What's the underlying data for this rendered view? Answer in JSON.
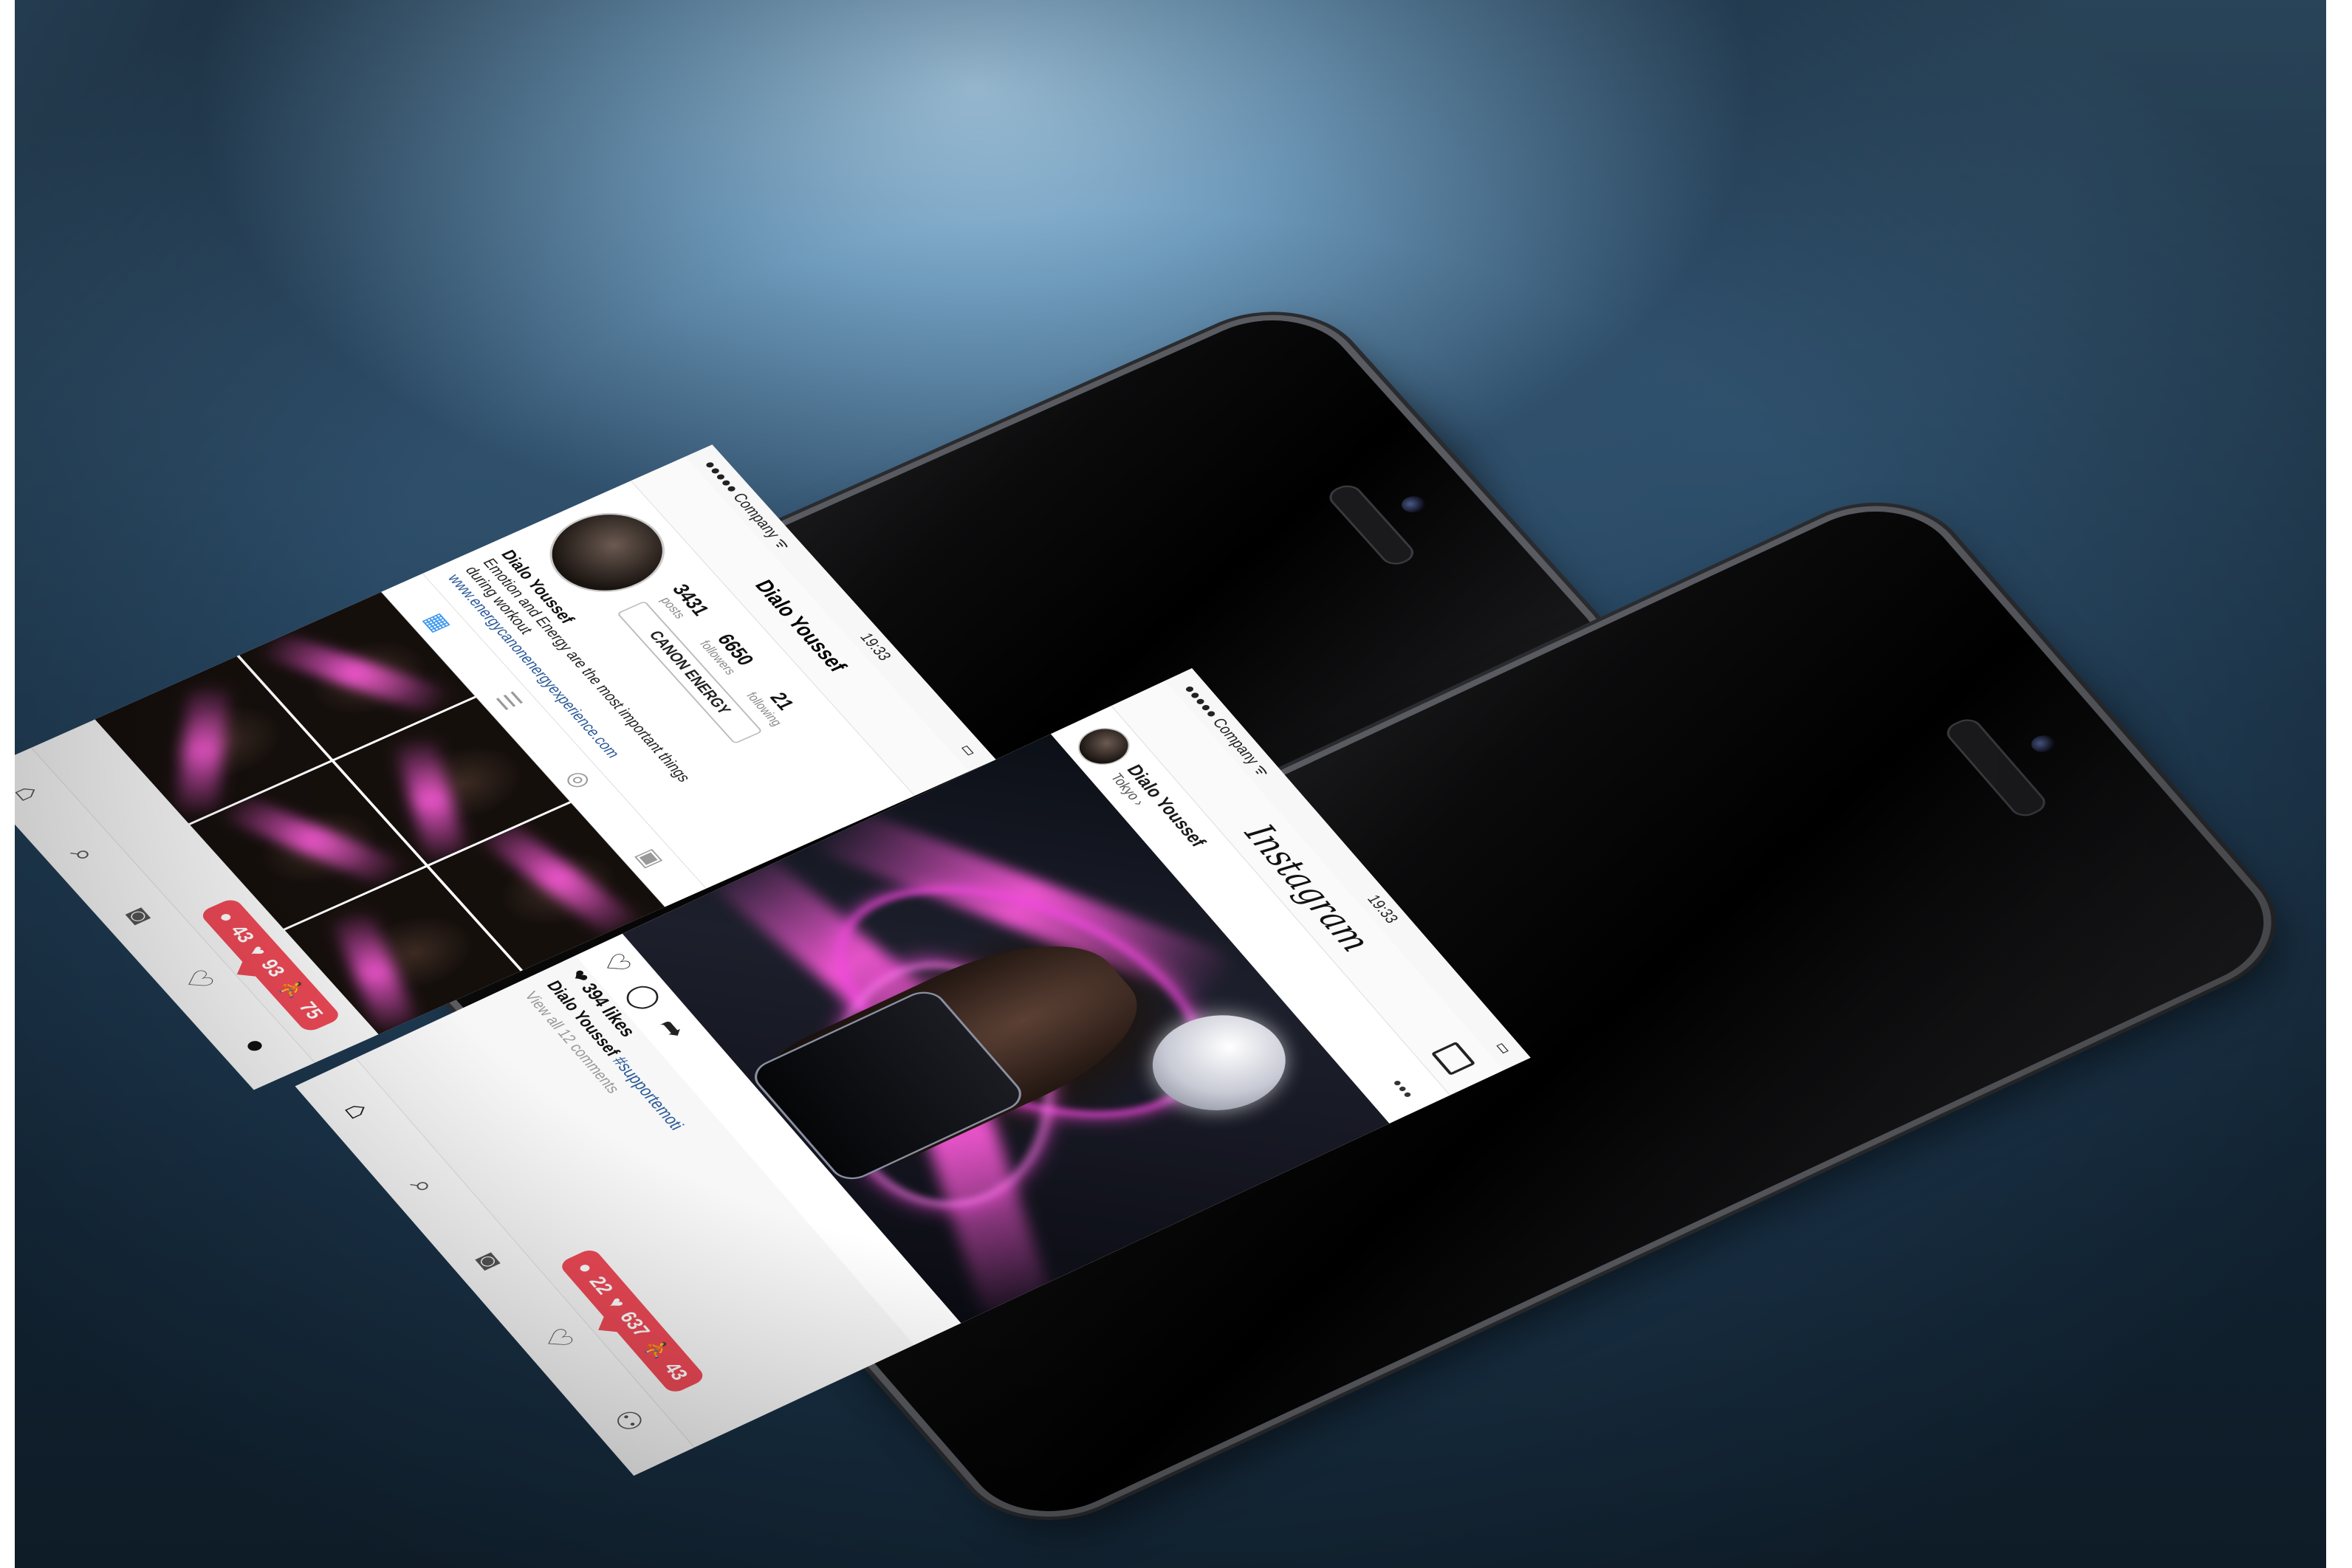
{
  "front_phone": {
    "status": {
      "carrier": "●●●●● Company ᯤ",
      "time": "19:33",
      "battery": "▭"
    },
    "header": {
      "logo": "Instagram"
    },
    "post": {
      "user": "Dialo Youssef",
      "location": "Tokyo ›",
      "more": "•••",
      "likes": "❤ 394 likes",
      "caption_user": "Dialo Youssef",
      "caption_tag": "#supportemoti",
      "comments": "View all 12 comments"
    },
    "notification": {
      "comments": "22",
      "likes": "637",
      "followers": "43"
    }
  },
  "back_phone": {
    "status": {
      "carrier": "●●●●● Company ᯤ",
      "time": "19:33"
    },
    "header": {
      "title": "Dialo Youssef"
    },
    "profile": {
      "posts_value": "3431",
      "posts_label": "posts",
      "followers_value": "6650",
      "followers_label": "followers",
      "following_value": "21",
      "following_label": "following",
      "button": "CANON ENERGY",
      "name": "Dialo Youssef",
      "bio_line1": "Emotion and Energy are the most important things",
      "bio_line2": "during workout",
      "link": "www.energycanonenergyexperience.com"
    },
    "notification": {
      "comments": "43",
      "likes": "93",
      "followers": "75"
    }
  },
  "colors": {
    "accent_red": "#ed4956",
    "link_blue": "#2a5a9a",
    "glow_pink": "#ee46dc"
  }
}
